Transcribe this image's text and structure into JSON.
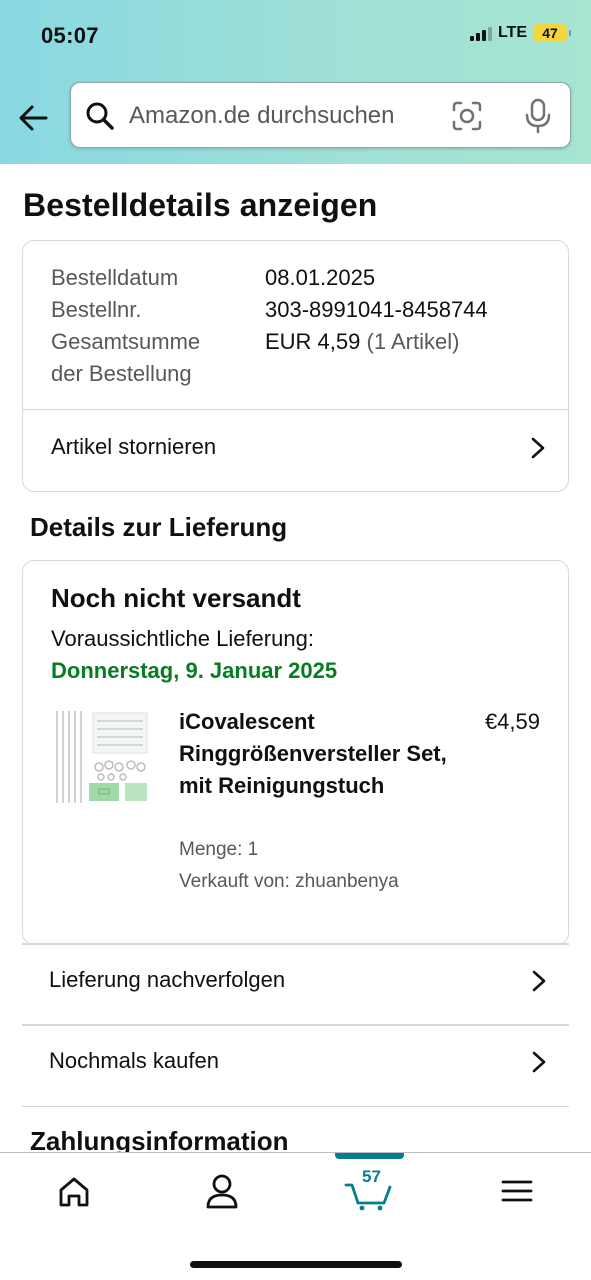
{
  "status_bar": {
    "time": "05:07",
    "network": "LTE",
    "battery": "47"
  },
  "search": {
    "placeholder": "Amazon.de durchsuchen"
  },
  "page_title": "Bestelldetails anzeigen",
  "order_summary": {
    "date_label": "Bestelldatum",
    "date_value": "08.01.2025",
    "number_label": "Bestellnr.",
    "number_value": "303-8991041-8458744",
    "total_label_line1": "Gesamtsumme",
    "total_label_line2": "der Bestellung",
    "total_value": "EUR 4,59",
    "total_items": "(1 Artikel)",
    "cancel_label": "Artikel stornieren"
  },
  "delivery": {
    "section_title": "Details zur Lieferung",
    "status": "Noch nicht versandt",
    "expected_label": "Voraussichtliche Lieferung:",
    "expected_date": "Donnerstag, 9. Januar 2025",
    "product": {
      "title": "iCovalescent Ringgrößenversteller Set, mit Reinigungstuch",
      "price": "€4,59",
      "quantity": "Menge: 1",
      "seller": "Verkauft von: zhuanbenya"
    }
  },
  "actions": {
    "track": "Lieferung nachverfolgen",
    "buy_again": "Nochmals kaufen"
  },
  "payment_title": "Zahlungsinformation",
  "tabbar": {
    "cart_count": "57",
    "icons": [
      "home-icon",
      "account-icon",
      "cart-icon",
      "menu-icon"
    ],
    "active": "cart",
    "accent_color": "#077d91"
  },
  "colors": {
    "delivery_green": "#067d23",
    "header_gradient": [
      "#88d8e3",
      "#a6e5d2"
    ]
  }
}
